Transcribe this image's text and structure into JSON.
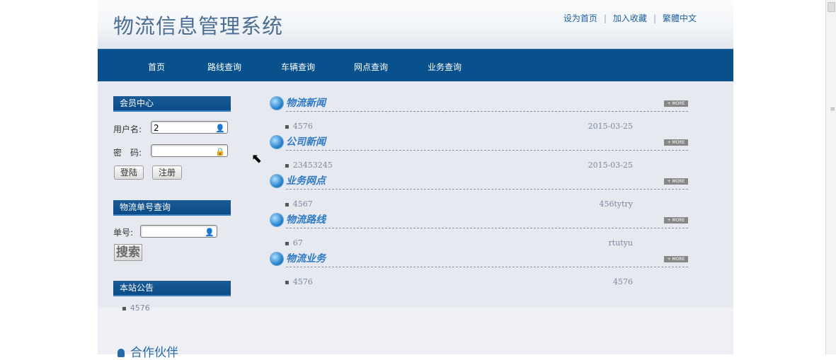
{
  "site": {
    "title": "物流信息管理系统"
  },
  "top_links": {
    "home": "设为首页",
    "favorite": "加入收藏",
    "traditional": "繁體中文",
    "sep": "|"
  },
  "nav": {
    "items": [
      {
        "label": "首页"
      },
      {
        "label": "路线查询"
      },
      {
        "label": "车辆查询"
      },
      {
        "label": "网点查询"
      },
      {
        "label": "业务查询"
      }
    ]
  },
  "member": {
    "heading": "会员中心",
    "username_label": "用户名:",
    "username_value": "2",
    "password_label": "密　码:",
    "login_button": "登陆",
    "register_button": "注册"
  },
  "tracking": {
    "heading": "物流单号查询",
    "number_label": "单号:",
    "search_button": "搜索"
  },
  "notice": {
    "heading": "本站公告",
    "items": [
      "4576"
    ]
  },
  "news_sections": [
    {
      "title": "物流新闻",
      "more": "+ MORE",
      "item": "4576",
      "date": "2015-03-25"
    },
    {
      "title": "公司新闻",
      "more": "+ MORE",
      "item": "23453245",
      "date": "2015-03-25"
    },
    {
      "title": "业务网点",
      "more": "+ MORE",
      "item": "4567",
      "date": "456tytry"
    },
    {
      "title": "物流路线",
      "more": "+ MORE",
      "item": "67",
      "date": "rtutyu"
    },
    {
      "title": "物流业务",
      "more": "+ MORE",
      "item": "4576",
      "date": "4576"
    }
  ],
  "partner": {
    "title": "合作伙伴"
  },
  "colors": {
    "nav_bg": "#08518c",
    "title": "#4c6e92",
    "link": "#1d5fa0",
    "news_title": "#2e7ac4"
  }
}
